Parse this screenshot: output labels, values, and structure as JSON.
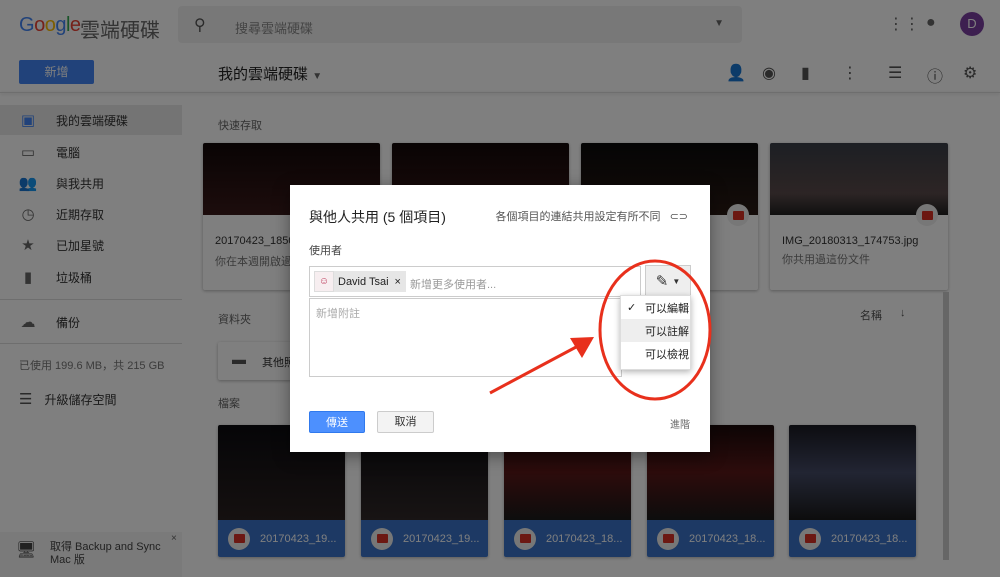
{
  "header": {
    "logo": "Google",
    "product": "雲端硬碟",
    "search_placeholder": "搜尋雲端硬碟",
    "avatar_letter": "D"
  },
  "toolbar": {
    "new_label": "新增",
    "breadcrumb": "我的雲端硬碟"
  },
  "sidebar": {
    "items": [
      {
        "label": "我的雲端硬碟"
      },
      {
        "label": "電腦"
      },
      {
        "label": "與我共用"
      },
      {
        "label": "近期存取"
      },
      {
        "label": "已加星號"
      },
      {
        "label": "垃圾桶"
      }
    ],
    "backup": "備份",
    "storage": "已使用 199.6 MB，共 215 GB",
    "upgrade": "升級儲存空間",
    "promo": "取得 Backup and Sync Mac 版"
  },
  "main": {
    "quick_access": "快速存取",
    "quick_cards": [
      {
        "name": "20170423_1850",
        "sub": "你在本週開啟過"
      },
      {
        "name": "",
        "sub": ""
      },
      {
        "name": "",
        "sub": ""
      },
      {
        "name": "IMG_20180313_174753.jpg",
        "sub": "你共用過這份文件"
      }
    ],
    "folders_label": "資料夾",
    "sort_label": "名稱",
    "folder_name": "其他照",
    "files_label": "檔案",
    "files": [
      {
        "name": "20170423_19..."
      },
      {
        "name": "20170423_19..."
      },
      {
        "name": "20170423_18..."
      },
      {
        "name": "20170423_18..."
      },
      {
        "name": "20170423_18..."
      }
    ]
  },
  "dialog": {
    "title": "與他人共用 (5 個項目)",
    "link_note": "各個項目的連結共用設定有所不同",
    "users_label": "使用者",
    "chip_name": "David Tsai",
    "chip_remove": "×",
    "add_users_placeholder": "新增更多使用者...",
    "note_placeholder": "新增附註",
    "permissions": [
      {
        "label": "可以編輯",
        "checked": true
      },
      {
        "label": "可以註解"
      },
      {
        "label": "可以檢視"
      }
    ],
    "send": "傳送",
    "cancel": "取消",
    "advanced": "進階"
  },
  "colors": {
    "accent": "#4285f4",
    "annotation": "#e8301c"
  }
}
